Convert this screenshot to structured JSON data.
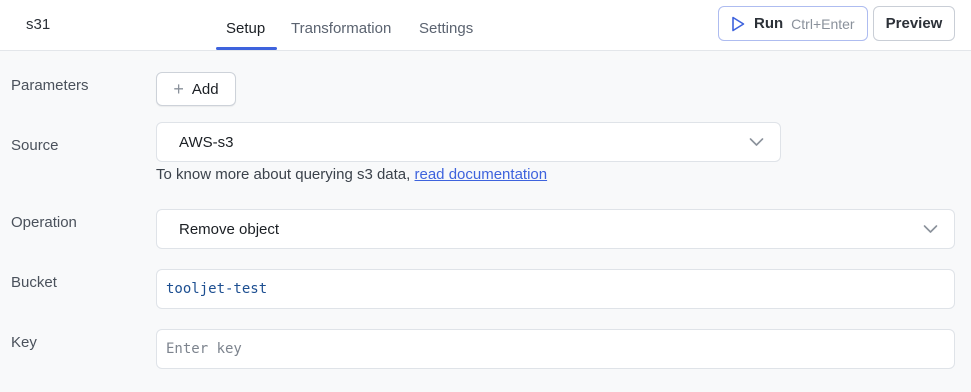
{
  "header": {
    "query_name": "s31",
    "tabs": [
      "Setup",
      "Transformation",
      "Settings"
    ],
    "active_tab": "Setup",
    "run_label": "Run",
    "run_shortcut": "Ctrl+Enter",
    "preview_label": "Preview"
  },
  "form": {
    "parameters_label": "Parameters",
    "add_label": "Add",
    "source_label": "Source",
    "source_value": "AWS-s3",
    "hint_text": "To know more about querying s3 data, ",
    "hint_link": "read documentation",
    "operation_label": "Operation",
    "operation_value": "Remove object",
    "bucket_label": "Bucket",
    "bucket_value": "tooljet-test",
    "key_label": "Key",
    "key_placeholder": "Enter key"
  },
  "colors": {
    "accent": "#3e63dd",
    "background": "#f8f9fa",
    "bucket_value_text": "#1d4f91"
  },
  "icons": [
    "play-icon",
    "plus-icon",
    "chevron-down-icon"
  ]
}
